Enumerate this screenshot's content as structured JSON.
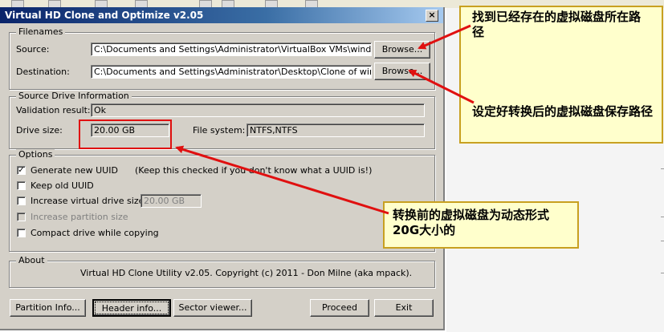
{
  "window": {
    "title": "Virtual HD Clone and Optimize v2.05",
    "close_glyph": "×"
  },
  "filenames": {
    "group_title": "Filenames",
    "source_label": "Source:",
    "source_value": "C:\\Documents and Settings\\Administrator\\VirtualBox VMs\\window XP SP",
    "destination_label": "Destination:",
    "destination_value": "C:\\Documents and Settings\\Administrator\\Desktop\\Clone of window XP",
    "browse_label": "Browse..."
  },
  "source_info": {
    "group_title": "Source Drive Information",
    "validation_label": "Validation result:",
    "validation_value": "Ok",
    "drive_size_label": "Drive size:",
    "drive_size_value": "20.00 GB",
    "filesystem_label": "File system:",
    "filesystem_value": "NTFS,NTFS"
  },
  "options": {
    "group_title": "Options",
    "generate_uuid": "Generate new UUID",
    "uuid_hint": "(Keep this checked if you don't know what a UUID is!)",
    "keep_uuid": "Keep old UUID",
    "increase_size": "Increase virtual drive size to",
    "increase_size_value": "20.00 GB",
    "increase_partition": "Increase partition size",
    "compact": "Compact drive while copying",
    "generate_uuid_checked": true
  },
  "about": {
    "group_title": "About",
    "text": "Virtual HD Clone Utility v2.05. Copyright (c) 2011 - Don Milne (aka mpack)."
  },
  "buttons": {
    "partition_info": "Partition Info...",
    "header_info": "Header info...",
    "sector_viewer": "Sector viewer...",
    "proceed": "Proceed",
    "exit": "Exit"
  },
  "annotations": {
    "source_note": "找到已经存在的虚拟磁盘所在路径",
    "destination_note": "设定好转换后的虚拟磁盘保存路径",
    "size_note": "转换前的虚拟磁盘为动态形式20G大小的"
  },
  "colors": {
    "dialog_face": "#d4d0c8",
    "title_bar": "#0a246a",
    "callout_fill": "#ffffcc",
    "arrow_red": "#e01010"
  }
}
